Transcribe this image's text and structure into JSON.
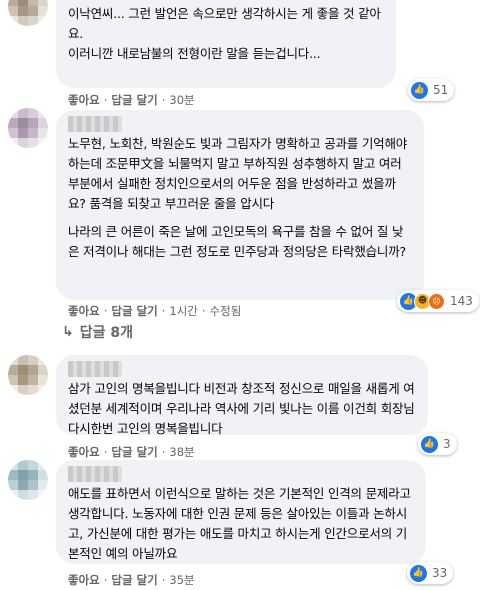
{
  "comments": [
    {
      "author": "",
      "paragraphs": [
        "이낙연씨... 그런 발언은 속으로만 생각하시는 게 좋을 것 같아요.\n이러니깐 내로남불의 전형이란 말을 듣는겁니다..."
      ],
      "reactions": {
        "icons": [
          "like-icon"
        ],
        "count": "51"
      },
      "actions": {
        "like": "좋아요",
        "reply": "답글 달기",
        "time": "30분",
        "edited": ""
      }
    },
    {
      "author": "",
      "paragraphs": [
        "노무현, 노회찬, 박원순도 빛과 그림자가 명확하고 공과를 기억해야 하는데 조문甲文을 뇌물먹지 말고 부하직원 성추행하지 말고 여러 부분에서 실패한 정치인으로서의 어두운 점을 반성하라고 썼을까요? 품격을 되찾고 부끄러운 줄을 압시다",
        "나라의 큰 어른이 죽은 날에 고인모독의 욕구를 참을 수 없어 질 낮은 저격이나 해대는 그런 정도로 민주당과 정의당은 타락했습니까?"
      ],
      "reactions": {
        "icons": [
          "like-icon",
          "haha-icon",
          "angry-icon"
        ],
        "count": "143"
      },
      "actions": {
        "like": "좋아요",
        "reply": "답글 달기",
        "time": "1시간",
        "edited": "수정됨"
      },
      "reply_count": "답글 8개"
    },
    {
      "author": "",
      "paragraphs": [
        "삼가 고인의 명복을빕니다 비전과 창조적 정신으로 매일을 새롭게 여셨던분 세계적이며 우리나라 역사에 기리 빛나는 이름 이건희 회장님 다시한번 고인의 명복을빕니다"
      ],
      "reactions": {
        "icons": [
          "like-icon"
        ],
        "count": "3"
      },
      "actions": {
        "like": "좋아요",
        "reply": "답글 달기",
        "time": "38분",
        "edited": ""
      }
    },
    {
      "author": "",
      "paragraphs": [
        "애도를 표하면서 이런식으로 말하는 것은 기본적인 인격의 문제라고 생각합니다. 노동자에 대한 인권 문제 등은 살아있는 이들과 논하시고, 가신분에 대한 평가는 애도를 마치고 하시는게 인간으로서의 기본적인 예의 아닐까요"
      ],
      "reactions": {
        "icons": [
          "like-icon"
        ],
        "count": "33"
      },
      "actions": {
        "like": "좋아요",
        "reply": "답글 달기",
        "time": "35분",
        "edited": ""
      }
    }
  ],
  "colors": {
    "bubble": "#f0f2f5",
    "like_blue": "#1877f2",
    "meta_gray": "#65676b"
  }
}
